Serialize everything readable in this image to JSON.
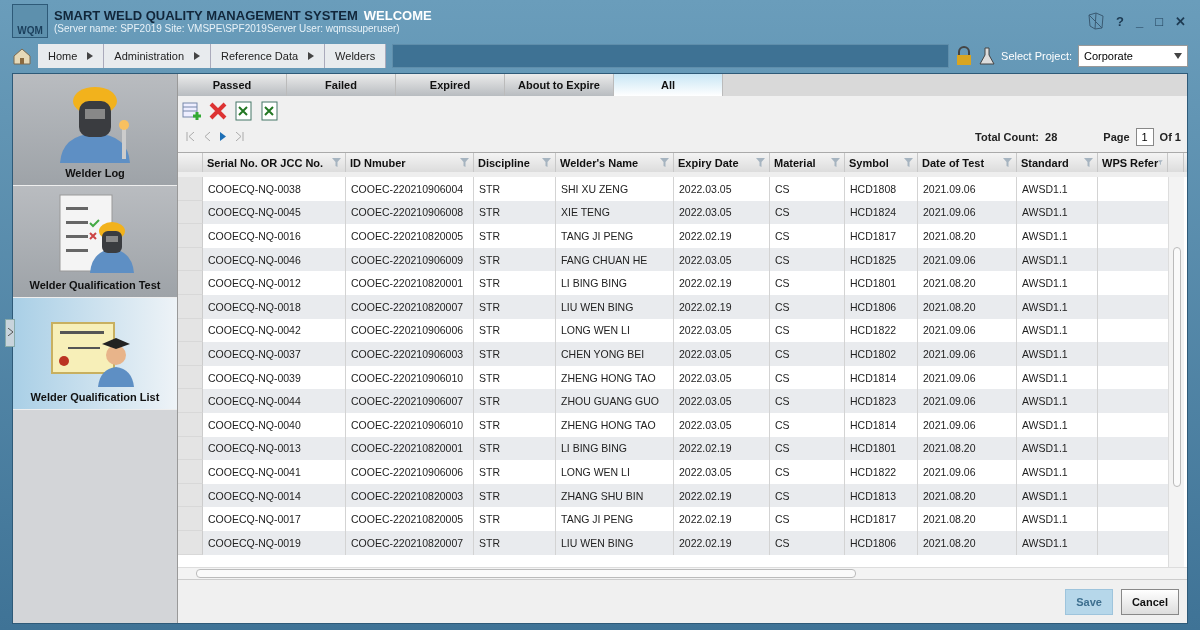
{
  "window": {
    "logo": "WQM",
    "title": "SMART WELD QUALITY MANAGEMENT SYSTEM",
    "welcome": "WELCOME",
    "server_info": "(Server name: SPF2019 Site: VMSPE\\SPF2019Server User: wqmssuperuser)",
    "controls": [
      "?",
      "_",
      "□",
      "✕"
    ]
  },
  "breadcrumb": [
    "Home",
    "Administration",
    "Reference Data",
    "Welders"
  ],
  "project": {
    "label": "Select Project:",
    "value": "Corporate"
  },
  "sidebar": {
    "items": [
      {
        "label": "Welder Log",
        "kind": "log",
        "selected": false
      },
      {
        "label": "Welder Qualification Test",
        "kind": "test",
        "selected": false
      },
      {
        "label": "Welder Qualification List",
        "kind": "list",
        "selected": true
      }
    ]
  },
  "tabs": [
    {
      "label": "Passed",
      "selected": false
    },
    {
      "label": "Failed",
      "selected": false
    },
    {
      "label": "Expired",
      "selected": false
    },
    {
      "label": "About to Expire",
      "selected": false
    },
    {
      "label": "All",
      "selected": true
    }
  ],
  "pager": {
    "total_label": "Total Count:",
    "total": "28",
    "page_label": "Page",
    "page": "1",
    "of_label": "Of 1"
  },
  "table": {
    "columns": [
      "Serial No. OR JCC No.",
      "ID Nmuber",
      "Discipline",
      "Welder's Name",
      "Expiry Date",
      "Material",
      "Symbol",
      "Date of Test",
      "Standard",
      "WPS Refer"
    ],
    "rows": [
      [
        "COOECQ-NQ-0038",
        "COOEC-220210906004",
        "STR",
        "SHI XU ZENG",
        "2022.03.05",
        "CS",
        "HCD1808",
        "2021.09.06",
        "AWSD1.1"
      ],
      [
        "COOECQ-NQ-0045",
        "COOEC-220210906008",
        "STR",
        "XIE TENG",
        "2022.03.05",
        "CS",
        "HCD1824",
        "2021.09.06",
        "AWSD1.1"
      ],
      [
        "COOECQ-NQ-0016",
        "COOEC-220210820005",
        "STR",
        "TANG JI PENG",
        "2022.02.19",
        "CS",
        "HCD1817",
        "2021.08.20",
        "AWSD1.1"
      ],
      [
        "COOECQ-NQ-0046",
        "COOEC-220210906009",
        "STR",
        "FANG CHUAN HE",
        "2022.03.05",
        "CS",
        "HCD1825",
        "2021.09.06",
        "AWSD1.1"
      ],
      [
        "COOECQ-NQ-0012",
        "COOEC-220210820001",
        "STR",
        "LI BING BING",
        "2022.02.19",
        "CS",
        "HCD1801",
        "2021.08.20",
        "AWSD1.1"
      ],
      [
        "COOECQ-NQ-0018",
        "COOEC-220210820007",
        "STR",
        "LIU WEN BING",
        "2022.02.19",
        "CS",
        "HCD1806",
        "2021.08.20",
        "AWSD1.1"
      ],
      [
        "COOECQ-NQ-0042",
        "COOEC-220210906006",
        "STR",
        "LONG WEN LI",
        "2022.03.05",
        "CS",
        "HCD1822",
        "2021.09.06",
        "AWSD1.1"
      ],
      [
        "COOECQ-NQ-0037",
        "COOEC-220210906003",
        "STR",
        "CHEN YONG BEI",
        "2022.03.05",
        "CS",
        "HCD1802",
        "2021.09.06",
        "AWSD1.1"
      ],
      [
        "COOECQ-NQ-0039",
        "COOEC-220210906010",
        "STR",
        "ZHENG HONG TAO",
        "2022.03.05",
        "CS",
        "HCD1814",
        "2021.09.06",
        "AWSD1.1"
      ],
      [
        "COOECQ-NQ-0044",
        "COOEC-220210906007",
        "STR",
        "ZHOU GUANG GUO",
        "2022.03.05",
        "CS",
        "HCD1823",
        "2021.09.06",
        "AWSD1.1"
      ],
      [
        "COOECQ-NQ-0040",
        "COOEC-220210906010",
        "STR",
        "ZHENG HONG TAO",
        "2022.03.05",
        "CS",
        "HCD1814",
        "2021.09.06",
        "AWSD1.1"
      ],
      [
        "COOECQ-NQ-0013",
        "COOEC-220210820001",
        "STR",
        "LI BING BING",
        "2022.02.19",
        "CS",
        "HCD1801",
        "2021.08.20",
        "AWSD1.1"
      ],
      [
        "COOECQ-NQ-0041",
        "COOEC-220210906006",
        "STR",
        "LONG WEN LI",
        "2022.03.05",
        "CS",
        "HCD1822",
        "2021.09.06",
        "AWSD1.1"
      ],
      [
        "COOECQ-NQ-0014",
        "COOEC-220210820003",
        "STR",
        "ZHANG SHU BIN",
        "2022.02.19",
        "CS",
        "HCD1813",
        "2021.08.20",
        "AWSD1.1"
      ],
      [
        "COOECQ-NQ-0017",
        "COOEC-220210820005",
        "STR",
        "TANG JI PENG",
        "2022.02.19",
        "CS",
        "HCD1817",
        "2021.08.20",
        "AWSD1.1"
      ],
      [
        "COOECQ-NQ-0019",
        "COOEC-220210820007",
        "STR",
        "LIU WEN BING",
        "2022.02.19",
        "CS",
        "HCD1806",
        "2021.08.20",
        "AWSD1.1"
      ]
    ]
  },
  "buttons": [
    {
      "label": "Save",
      "disabled": true
    },
    {
      "label": "Cancel",
      "disabled": false
    }
  ]
}
